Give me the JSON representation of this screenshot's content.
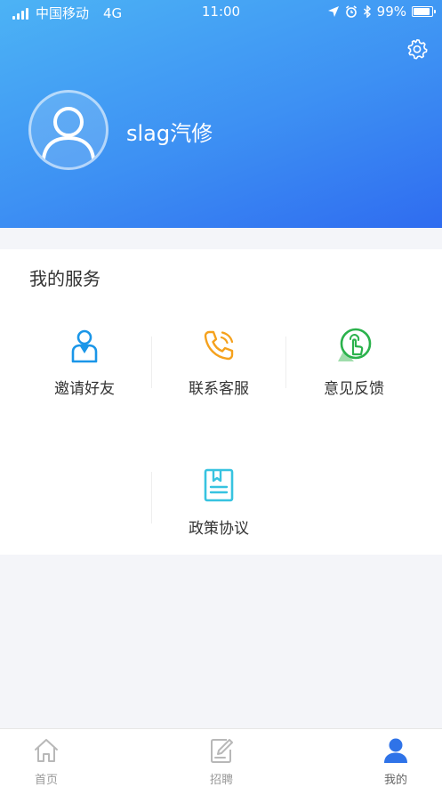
{
  "status_bar": {
    "carrier": "中国移动",
    "network": "4G",
    "time": "11:00",
    "battery_text": "99%",
    "battery_level": 0.99
  },
  "profile": {
    "username": "slag汽修",
    "avatar_icon": "user-avatar-icon",
    "settings_icon": "gear-icon"
  },
  "services": {
    "title": "我的服务",
    "items": [
      {
        "label": "邀请好友",
        "icon": "invite-friend-icon",
        "color": "#1a96e8"
      },
      {
        "label": "联系客服",
        "icon": "phone-icon",
        "color": "#f5a11c"
      },
      {
        "label": "意见反馈",
        "icon": "feedback-hand-icon",
        "color": "#2bb24c"
      },
      {
        "label": "政策协议",
        "icon": "policy-document-icon",
        "color": "#37c3e0"
      }
    ]
  },
  "tabbar": {
    "items": [
      {
        "label": "首页",
        "icon": "home-icon"
      },
      {
        "label": "招聘",
        "icon": "edit-note-icon"
      },
      {
        "label": "我的",
        "icon": "user-icon",
        "active": true
      }
    ]
  },
  "colors": {
    "header_start": "#4cb3f5",
    "header_end": "#2f6cf0",
    "active_tab": "#2f73e8"
  }
}
